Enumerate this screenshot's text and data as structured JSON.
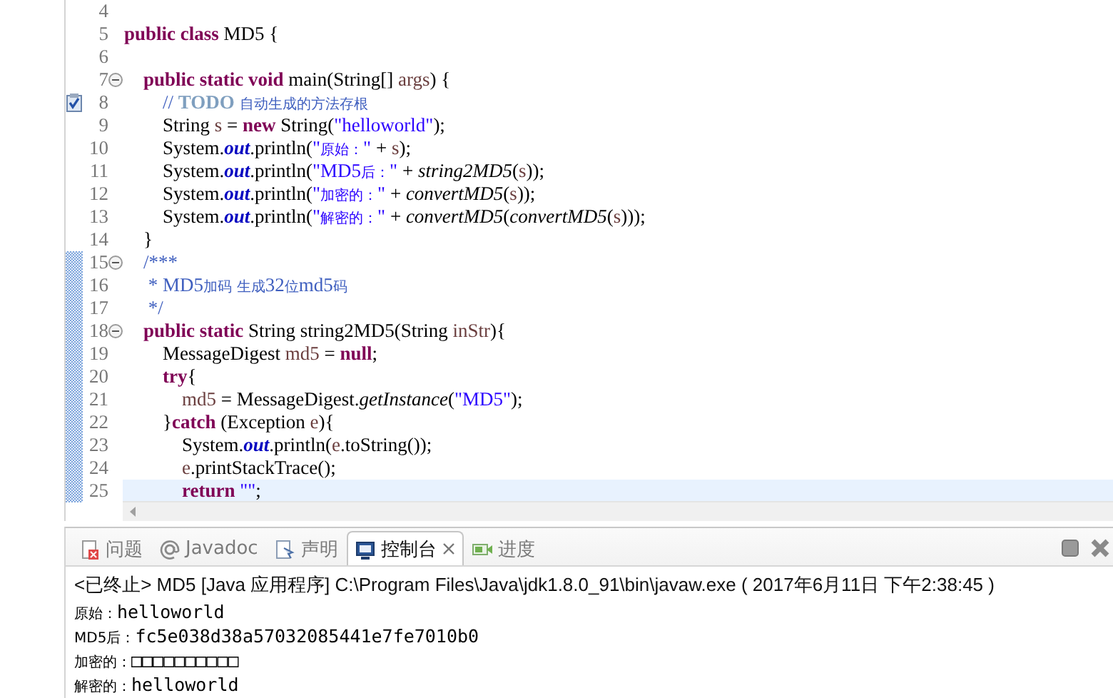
{
  "editor": {
    "lines": [
      {
        "number": "4",
        "fold": false,
        "task": false,
        "changed": false,
        "current": false
      },
      {
        "number": "5",
        "fold": false,
        "task": false,
        "changed": false,
        "current": false,
        "tokens": [
          {
            "kind": "kw",
            "text": "public class"
          },
          {
            "kind": "plain",
            "text": " MD5 {"
          }
        ]
      },
      {
        "number": "6",
        "fold": false,
        "task": false,
        "changed": false,
        "current": false
      },
      {
        "number": "7",
        "fold": true,
        "task": false,
        "changed": false,
        "current": false,
        "tokens": [
          {
            "kind": "kw",
            "text": "    public static void"
          },
          {
            "kind": "plain",
            "text": " main(String[] "
          },
          {
            "kind": "var",
            "text": "args"
          },
          {
            "kind": "plain",
            "text": ") {"
          }
        ]
      },
      {
        "number": "8",
        "fold": false,
        "task": true,
        "changed": false,
        "current": false,
        "tokens": [
          {
            "kind": "comment",
            "text": "        // "
          },
          {
            "kind": "todo",
            "text": "TODO"
          },
          {
            "kind": "comment",
            "text": " 自动生成的方法存根"
          }
        ]
      },
      {
        "number": "9",
        "fold": false,
        "task": false,
        "changed": false,
        "current": false,
        "tokens": [
          {
            "kind": "plain",
            "text": "        String "
          },
          {
            "kind": "var",
            "text": "s"
          },
          {
            "kind": "plain",
            "text": " = "
          },
          {
            "kind": "kw",
            "text": "new"
          },
          {
            "kind": "plain",
            "text": " String("
          },
          {
            "kind": "str",
            "text": "\"helloworld\""
          },
          {
            "kind": "plain",
            "text": ");"
          }
        ]
      },
      {
        "number": "10",
        "fold": false,
        "task": false,
        "changed": false,
        "current": false,
        "tokens": [
          {
            "kind": "plain",
            "text": "        System."
          },
          {
            "kind": "field",
            "text": "out"
          },
          {
            "kind": "plain",
            "text": ".println("
          },
          {
            "kind": "str",
            "text": "\"原始：\""
          },
          {
            "kind": "plain",
            "text": " + "
          },
          {
            "kind": "var",
            "text": "s"
          },
          {
            "kind": "plain",
            "text": ");"
          }
        ]
      },
      {
        "number": "11",
        "fold": false,
        "task": false,
        "changed": false,
        "current": false,
        "tokens": [
          {
            "kind": "plain",
            "text": "        System."
          },
          {
            "kind": "field",
            "text": "out"
          },
          {
            "kind": "plain",
            "text": ".println("
          },
          {
            "kind": "str",
            "text": "\"MD5后：\""
          },
          {
            "kind": "plain",
            "text": " + "
          },
          {
            "kind": "static",
            "text": "string2MD5"
          },
          {
            "kind": "plain",
            "text": "("
          },
          {
            "kind": "var",
            "text": "s"
          },
          {
            "kind": "plain",
            "text": "));"
          }
        ]
      },
      {
        "number": "12",
        "fold": false,
        "task": false,
        "changed": false,
        "current": false,
        "tokens": [
          {
            "kind": "plain",
            "text": "        System."
          },
          {
            "kind": "field",
            "text": "out"
          },
          {
            "kind": "plain",
            "text": ".println("
          },
          {
            "kind": "str",
            "text": "\"加密的：\""
          },
          {
            "kind": "plain",
            "text": " + "
          },
          {
            "kind": "static",
            "text": "convertMD5"
          },
          {
            "kind": "plain",
            "text": "("
          },
          {
            "kind": "var",
            "text": "s"
          },
          {
            "kind": "plain",
            "text": "));"
          }
        ]
      },
      {
        "number": "13",
        "fold": false,
        "task": false,
        "changed": false,
        "current": false,
        "tokens": [
          {
            "kind": "plain",
            "text": "        System."
          },
          {
            "kind": "field",
            "text": "out"
          },
          {
            "kind": "plain",
            "text": ".println("
          },
          {
            "kind": "str",
            "text": "\"解密的：\""
          },
          {
            "kind": "plain",
            "text": " + "
          },
          {
            "kind": "static",
            "text": "convertMD5"
          },
          {
            "kind": "plain",
            "text": "("
          },
          {
            "kind": "static",
            "text": "convertMD5"
          },
          {
            "kind": "plain",
            "text": "("
          },
          {
            "kind": "var",
            "text": "s"
          },
          {
            "kind": "plain",
            "text": ")));"
          }
        ]
      },
      {
        "number": "14",
        "fold": false,
        "task": false,
        "changed": false,
        "current": false,
        "tokens": [
          {
            "kind": "plain",
            "text": "    }"
          }
        ]
      },
      {
        "number": "15",
        "fold": true,
        "task": false,
        "changed": true,
        "current": false,
        "tokens": [
          {
            "kind": "doc",
            "text": "    /***"
          }
        ]
      },
      {
        "number": "16",
        "fold": false,
        "task": false,
        "changed": true,
        "current": false,
        "tokens": [
          {
            "kind": "doc",
            "text": "     * MD5加码 生成32位md5码"
          }
        ]
      },
      {
        "number": "17",
        "fold": false,
        "task": false,
        "changed": true,
        "current": false,
        "tokens": [
          {
            "kind": "doc",
            "text": "     */"
          }
        ]
      },
      {
        "number": "18",
        "fold": true,
        "task": false,
        "changed": true,
        "current": false,
        "tokens": [
          {
            "kind": "kw",
            "text": "    public static"
          },
          {
            "kind": "plain",
            "text": " String string2MD5(String "
          },
          {
            "kind": "var",
            "text": "inStr"
          },
          {
            "kind": "plain",
            "text": "){"
          }
        ]
      },
      {
        "number": "19",
        "fold": false,
        "task": false,
        "changed": true,
        "current": false,
        "tokens": [
          {
            "kind": "plain",
            "text": "        MessageDigest "
          },
          {
            "kind": "var",
            "text": "md5"
          },
          {
            "kind": "plain",
            "text": " = "
          },
          {
            "kind": "kw",
            "text": "null"
          },
          {
            "kind": "plain",
            "text": ";"
          }
        ]
      },
      {
        "number": "20",
        "fold": false,
        "task": false,
        "changed": true,
        "current": false,
        "tokens": [
          {
            "kind": "kw",
            "text": "        try"
          },
          {
            "kind": "plain",
            "text": "{"
          }
        ]
      },
      {
        "number": "21",
        "fold": false,
        "task": false,
        "changed": true,
        "current": false,
        "tokens": [
          {
            "kind": "var",
            "text": "            md5"
          },
          {
            "kind": "plain",
            "text": " = MessageDigest."
          },
          {
            "kind": "static",
            "text": "getInstance"
          },
          {
            "kind": "plain",
            "text": "("
          },
          {
            "kind": "str",
            "text": "\"MD5\""
          },
          {
            "kind": "plain",
            "text": ");"
          }
        ]
      },
      {
        "number": "22",
        "fold": false,
        "task": false,
        "changed": true,
        "current": false,
        "tokens": [
          {
            "kind": "plain",
            "text": "        }"
          },
          {
            "kind": "kw",
            "text": "catch"
          },
          {
            "kind": "plain",
            "text": " (Exception "
          },
          {
            "kind": "var",
            "text": "e"
          },
          {
            "kind": "plain",
            "text": "){"
          }
        ]
      },
      {
        "number": "23",
        "fold": false,
        "task": false,
        "changed": true,
        "current": false,
        "tokens": [
          {
            "kind": "plain",
            "text": "            System."
          },
          {
            "kind": "field",
            "text": "out"
          },
          {
            "kind": "plain",
            "text": ".println("
          },
          {
            "kind": "var",
            "text": "e"
          },
          {
            "kind": "plain",
            "text": ".toString());"
          }
        ]
      },
      {
        "number": "24",
        "fold": false,
        "task": false,
        "changed": true,
        "current": false,
        "tokens": [
          {
            "kind": "var",
            "text": "            e"
          },
          {
            "kind": "plain",
            "text": ".printStackTrace();"
          }
        ]
      },
      {
        "number": "25",
        "fold": false,
        "task": false,
        "changed": true,
        "current": true,
        "tokens": [
          {
            "kind": "kw",
            "text": "            return"
          },
          {
            "kind": "str",
            "text": " \"\""
          },
          {
            "kind": "plain",
            "text": ";"
          }
        ]
      }
    ]
  },
  "console": {
    "tabs": [
      {
        "label": "问题",
        "selected": false
      },
      {
        "label": "Javadoc",
        "selected": false
      },
      {
        "label": "声明",
        "selected": false
      },
      {
        "label": "控制台",
        "selected": true
      },
      {
        "label": "进度",
        "selected": false
      }
    ],
    "header": "<已终止> MD5 [Java 应用程序] C:\\Program Files\\Java\\jdk1.8.0_91\\bin\\javaw.exe ( 2017年6月11日 下午2:38:45 )",
    "output": [
      {
        "label": "原始：",
        "value": "helloworld"
      },
      {
        "label": "MD5后：",
        "value": "fc5e038d38a57032085441e7fe7010b0"
      },
      {
        "label": "加密的：",
        "value": "□□□□□□□□□□"
      },
      {
        "label": "解密的：",
        "value": "helloworld"
      }
    ]
  }
}
